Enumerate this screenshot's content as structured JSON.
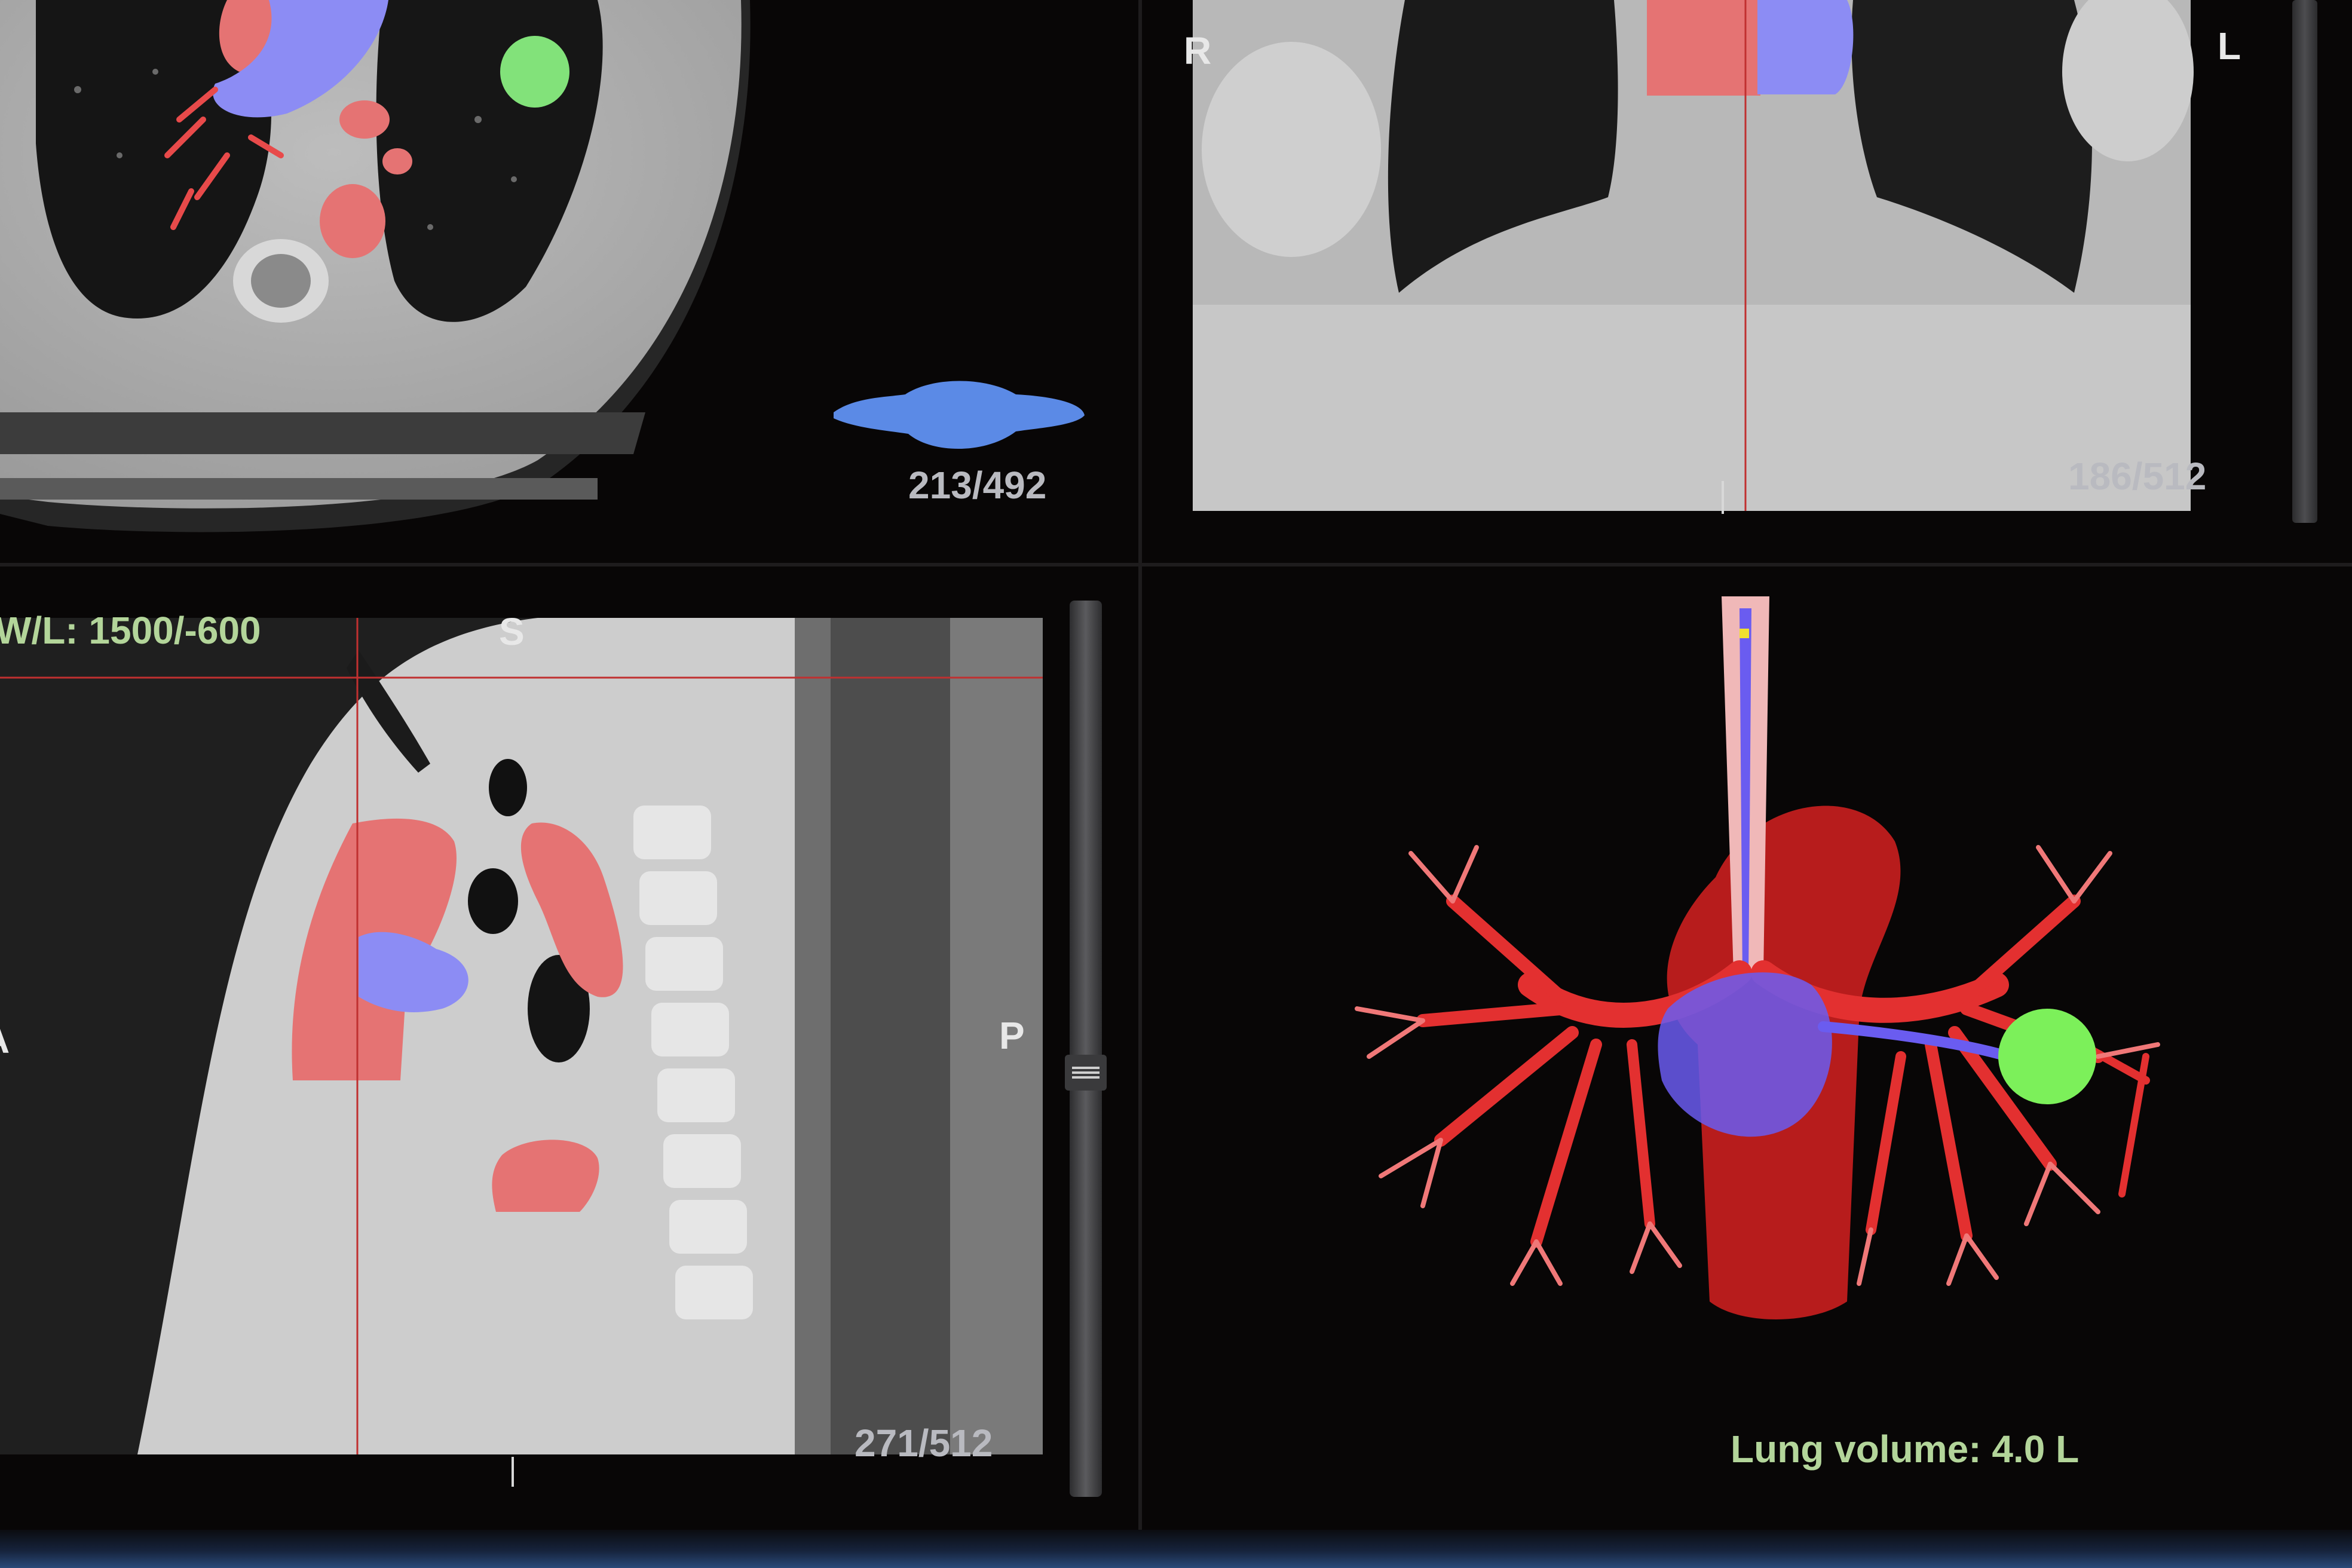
{
  "axial": {
    "slice": "213/492"
  },
  "coronal": {
    "slice": "186/512",
    "left_label": "R",
    "right_label": "L"
  },
  "sagittal": {
    "slice": "271/512",
    "window_level": "W/L: 1500/-600",
    "top_label": "S",
    "left_label": "A",
    "right_label": "P"
  },
  "volume3d": {
    "lung_volume": "Lung volume: 4.0 L"
  },
  "icons": {
    "orientation_marker": "lung-orientation-icon",
    "slider": "slice-slider"
  },
  "colors": {
    "artery": "#e02a2a",
    "vein": "#7a6cf0",
    "nodule": "#7cf05a",
    "overlay_red": "#e57373",
    "overlay_blue": "#8c8cf4",
    "overlay_green": "#82e27a",
    "label_green": "#b3d59a"
  }
}
